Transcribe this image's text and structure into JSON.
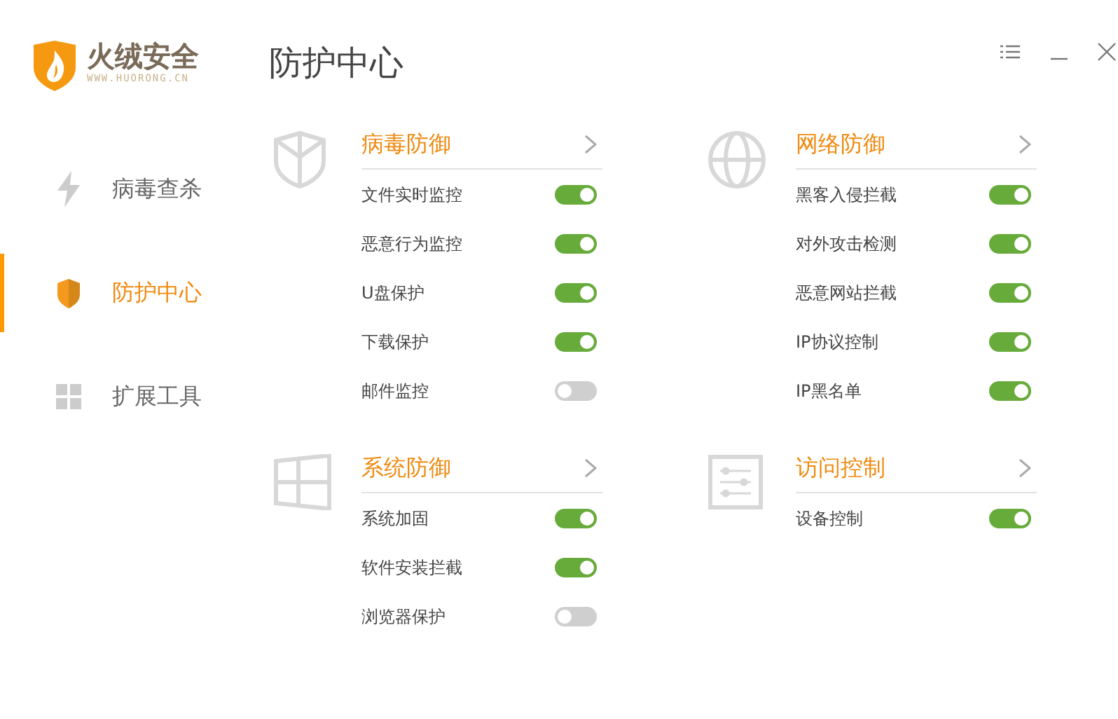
{
  "logo": {
    "name": "火绒安全",
    "url": "WWW.HUORONG.CN"
  },
  "nav": [
    {
      "label": "病毒查杀",
      "kind": "bolt",
      "selected": false
    },
    {
      "label": "防护中心",
      "kind": "shield",
      "selected": true
    },
    {
      "label": "扩展工具",
      "kind": "grid",
      "selected": false
    }
  ],
  "title": "防护中心",
  "sections": [
    {
      "title": "病毒防御",
      "kind": "shield",
      "items": [
        {
          "label": "文件实时监控",
          "on": true
        },
        {
          "label": "恶意行为监控",
          "on": true
        },
        {
          "label": "U盘保护",
          "on": true
        },
        {
          "label": "下载保护",
          "on": true
        },
        {
          "label": "邮件监控",
          "on": false
        }
      ]
    },
    {
      "title": "网络防御",
      "kind": "globe",
      "items": [
        {
          "label": "黑客入侵拦截",
          "on": true
        },
        {
          "label": "对外攻击检测",
          "on": true
        },
        {
          "label": "恶意网站拦截",
          "on": true
        },
        {
          "label": "IP协议控制",
          "on": true
        },
        {
          "label": "IP黑名单",
          "on": true
        }
      ]
    },
    {
      "title": "系统防御",
      "kind": "windows",
      "items": [
        {
          "label": "系统加固",
          "on": true
        },
        {
          "label": "软件安装拦截",
          "on": true
        },
        {
          "label": "浏览器保护",
          "on": false
        }
      ]
    },
    {
      "title": "访问控制",
      "kind": "sliders",
      "items": [
        {
          "label": "设备控制",
          "on": true
        }
      ]
    }
  ]
}
